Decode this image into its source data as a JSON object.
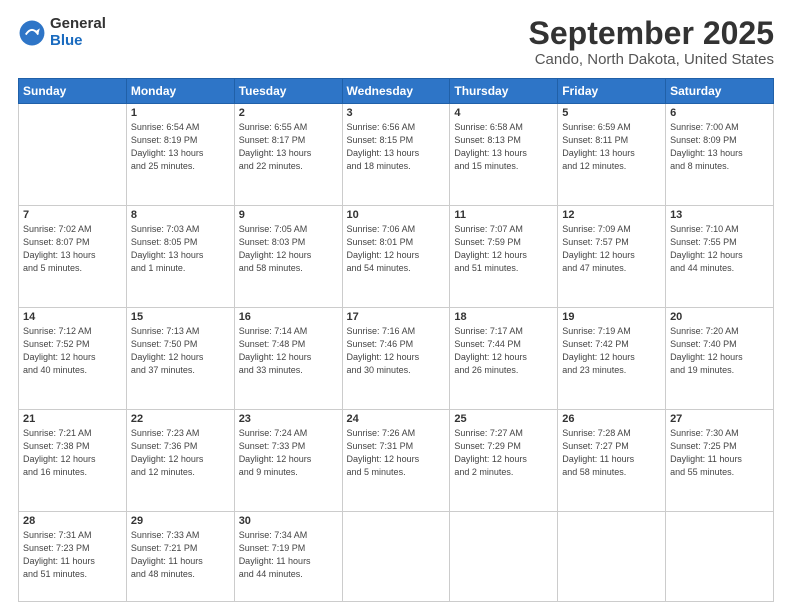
{
  "logo": {
    "general": "General",
    "blue": "Blue"
  },
  "title": "September 2025",
  "subtitle": "Cando, North Dakota, United States",
  "days_of_week": [
    "Sunday",
    "Monday",
    "Tuesday",
    "Wednesday",
    "Thursday",
    "Friday",
    "Saturday"
  ],
  "weeks": [
    [
      {
        "day": "",
        "info": ""
      },
      {
        "day": "1",
        "info": "Sunrise: 6:54 AM\nSunset: 8:19 PM\nDaylight: 13 hours\nand 25 minutes."
      },
      {
        "day": "2",
        "info": "Sunrise: 6:55 AM\nSunset: 8:17 PM\nDaylight: 13 hours\nand 22 minutes."
      },
      {
        "day": "3",
        "info": "Sunrise: 6:56 AM\nSunset: 8:15 PM\nDaylight: 13 hours\nand 18 minutes."
      },
      {
        "day": "4",
        "info": "Sunrise: 6:58 AM\nSunset: 8:13 PM\nDaylight: 13 hours\nand 15 minutes."
      },
      {
        "day": "5",
        "info": "Sunrise: 6:59 AM\nSunset: 8:11 PM\nDaylight: 13 hours\nand 12 minutes."
      },
      {
        "day": "6",
        "info": "Sunrise: 7:00 AM\nSunset: 8:09 PM\nDaylight: 13 hours\nand 8 minutes."
      }
    ],
    [
      {
        "day": "7",
        "info": "Sunrise: 7:02 AM\nSunset: 8:07 PM\nDaylight: 13 hours\nand 5 minutes."
      },
      {
        "day": "8",
        "info": "Sunrise: 7:03 AM\nSunset: 8:05 PM\nDaylight: 13 hours\nand 1 minute."
      },
      {
        "day": "9",
        "info": "Sunrise: 7:05 AM\nSunset: 8:03 PM\nDaylight: 12 hours\nand 58 minutes."
      },
      {
        "day": "10",
        "info": "Sunrise: 7:06 AM\nSunset: 8:01 PM\nDaylight: 12 hours\nand 54 minutes."
      },
      {
        "day": "11",
        "info": "Sunrise: 7:07 AM\nSunset: 7:59 PM\nDaylight: 12 hours\nand 51 minutes."
      },
      {
        "day": "12",
        "info": "Sunrise: 7:09 AM\nSunset: 7:57 PM\nDaylight: 12 hours\nand 47 minutes."
      },
      {
        "day": "13",
        "info": "Sunrise: 7:10 AM\nSunset: 7:55 PM\nDaylight: 12 hours\nand 44 minutes."
      }
    ],
    [
      {
        "day": "14",
        "info": "Sunrise: 7:12 AM\nSunset: 7:52 PM\nDaylight: 12 hours\nand 40 minutes."
      },
      {
        "day": "15",
        "info": "Sunrise: 7:13 AM\nSunset: 7:50 PM\nDaylight: 12 hours\nand 37 minutes."
      },
      {
        "day": "16",
        "info": "Sunrise: 7:14 AM\nSunset: 7:48 PM\nDaylight: 12 hours\nand 33 minutes."
      },
      {
        "day": "17",
        "info": "Sunrise: 7:16 AM\nSunset: 7:46 PM\nDaylight: 12 hours\nand 30 minutes."
      },
      {
        "day": "18",
        "info": "Sunrise: 7:17 AM\nSunset: 7:44 PM\nDaylight: 12 hours\nand 26 minutes."
      },
      {
        "day": "19",
        "info": "Sunrise: 7:19 AM\nSunset: 7:42 PM\nDaylight: 12 hours\nand 23 minutes."
      },
      {
        "day": "20",
        "info": "Sunrise: 7:20 AM\nSunset: 7:40 PM\nDaylight: 12 hours\nand 19 minutes."
      }
    ],
    [
      {
        "day": "21",
        "info": "Sunrise: 7:21 AM\nSunset: 7:38 PM\nDaylight: 12 hours\nand 16 minutes."
      },
      {
        "day": "22",
        "info": "Sunrise: 7:23 AM\nSunset: 7:36 PM\nDaylight: 12 hours\nand 12 minutes."
      },
      {
        "day": "23",
        "info": "Sunrise: 7:24 AM\nSunset: 7:33 PM\nDaylight: 12 hours\nand 9 minutes."
      },
      {
        "day": "24",
        "info": "Sunrise: 7:26 AM\nSunset: 7:31 PM\nDaylight: 12 hours\nand 5 minutes."
      },
      {
        "day": "25",
        "info": "Sunrise: 7:27 AM\nSunset: 7:29 PM\nDaylight: 12 hours\nand 2 minutes."
      },
      {
        "day": "26",
        "info": "Sunrise: 7:28 AM\nSunset: 7:27 PM\nDaylight: 11 hours\nand 58 minutes."
      },
      {
        "day": "27",
        "info": "Sunrise: 7:30 AM\nSunset: 7:25 PM\nDaylight: 11 hours\nand 55 minutes."
      }
    ],
    [
      {
        "day": "28",
        "info": "Sunrise: 7:31 AM\nSunset: 7:23 PM\nDaylight: 11 hours\nand 51 minutes."
      },
      {
        "day": "29",
        "info": "Sunrise: 7:33 AM\nSunset: 7:21 PM\nDaylight: 11 hours\nand 48 minutes."
      },
      {
        "day": "30",
        "info": "Sunrise: 7:34 AM\nSunset: 7:19 PM\nDaylight: 11 hours\nand 44 minutes."
      },
      {
        "day": "",
        "info": ""
      },
      {
        "day": "",
        "info": ""
      },
      {
        "day": "",
        "info": ""
      },
      {
        "day": "",
        "info": ""
      }
    ]
  ]
}
